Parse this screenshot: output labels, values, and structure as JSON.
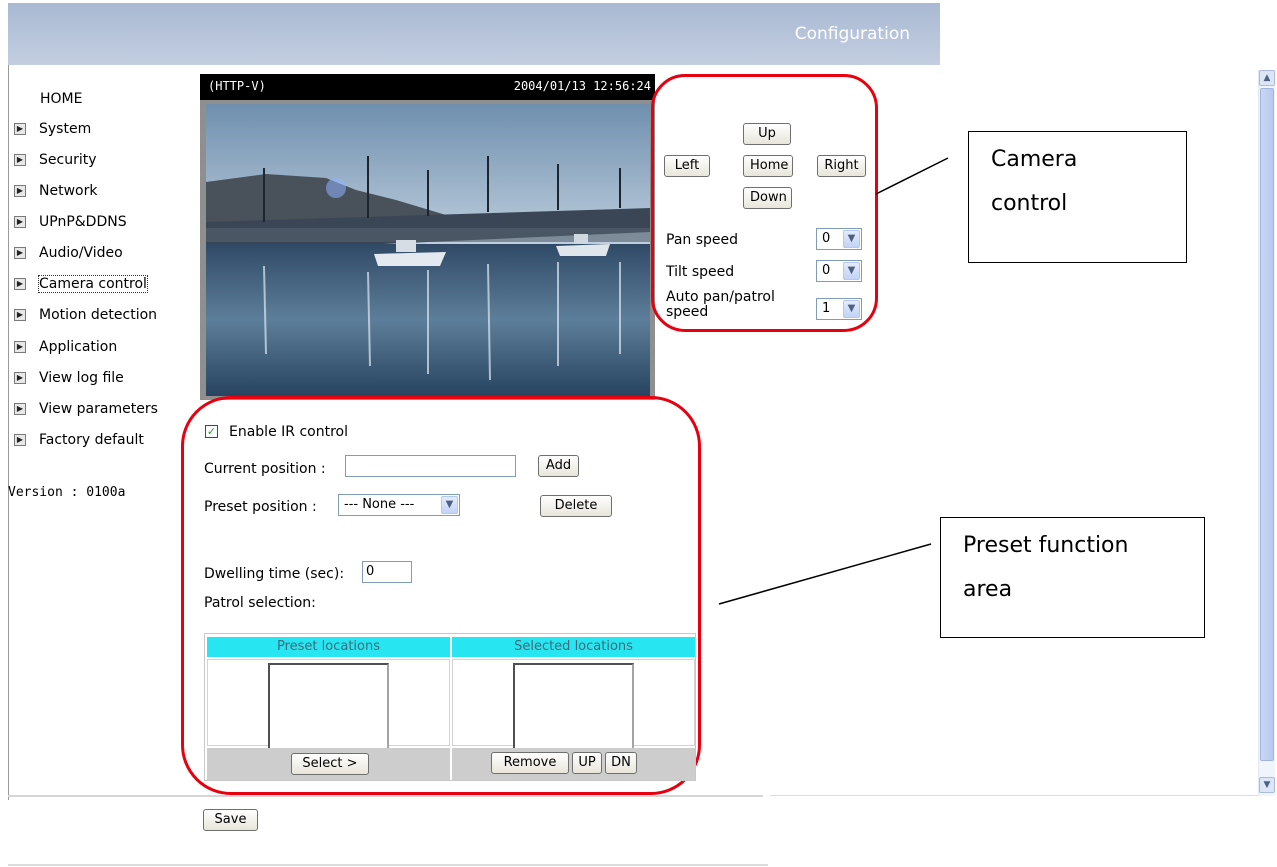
{
  "header": {
    "title": "Configuration"
  },
  "sidebar": {
    "home": "HOME",
    "items": [
      {
        "label": "System"
      },
      {
        "label": "Security"
      },
      {
        "label": "Network"
      },
      {
        "label": "UPnP&DDNS"
      },
      {
        "label": "Audio/Video"
      },
      {
        "label": "Camera control",
        "focused": true
      },
      {
        "label": "Motion detection"
      },
      {
        "label": "Application"
      },
      {
        "label": "View log file"
      },
      {
        "label": "View parameters"
      },
      {
        "label": "Factory default"
      }
    ],
    "version": "Version : 0100a"
  },
  "camera": {
    "label": "(HTTP-V)",
    "timestamp": "2004/01/13 12:56:24"
  },
  "ptz": {
    "up": "Up",
    "left": "Left",
    "home": "Home",
    "right": "Right",
    "down": "Down",
    "pan_speed_label": "Pan speed",
    "pan_speed_value": "0",
    "tilt_speed_label": "Tilt speed",
    "tilt_speed_value": "0",
    "auto_pan_label_line1": "Auto pan/patrol",
    "auto_pan_label_line2": "speed",
    "auto_pan_value": "1"
  },
  "preset": {
    "enable_ir_label": "Enable IR control",
    "enable_ir_checked": true,
    "current_position_label": "Current position :",
    "current_position_value": "",
    "add_button": "Add",
    "preset_position_label": "Preset position :",
    "preset_position_value": "--- None ---",
    "delete_button": "Delete",
    "dwelling_label": "Dwelling time (sec):",
    "dwelling_value": "0",
    "patrol_label": "Patrol selection:",
    "preset_locations_header": "Preset locations",
    "selected_locations_header": "Selected locations",
    "select_button": "Select >",
    "remove_button": "Remove",
    "up_button": "UP",
    "dn_button": "DN",
    "save_button": "Save"
  },
  "annotations": {
    "camera_control_line1": "Camera",
    "camera_control_line2": "control",
    "preset_area_line1": "Preset function",
    "preset_area_line2": "area",
    "ring_color": "#e8000f"
  },
  "icons": {
    "nav_arrow": "arrow-right-icon",
    "dropdown": "chevron-down-icon",
    "scroll_up": "scroll-up-icon",
    "scroll_down": "scroll-down-icon"
  }
}
